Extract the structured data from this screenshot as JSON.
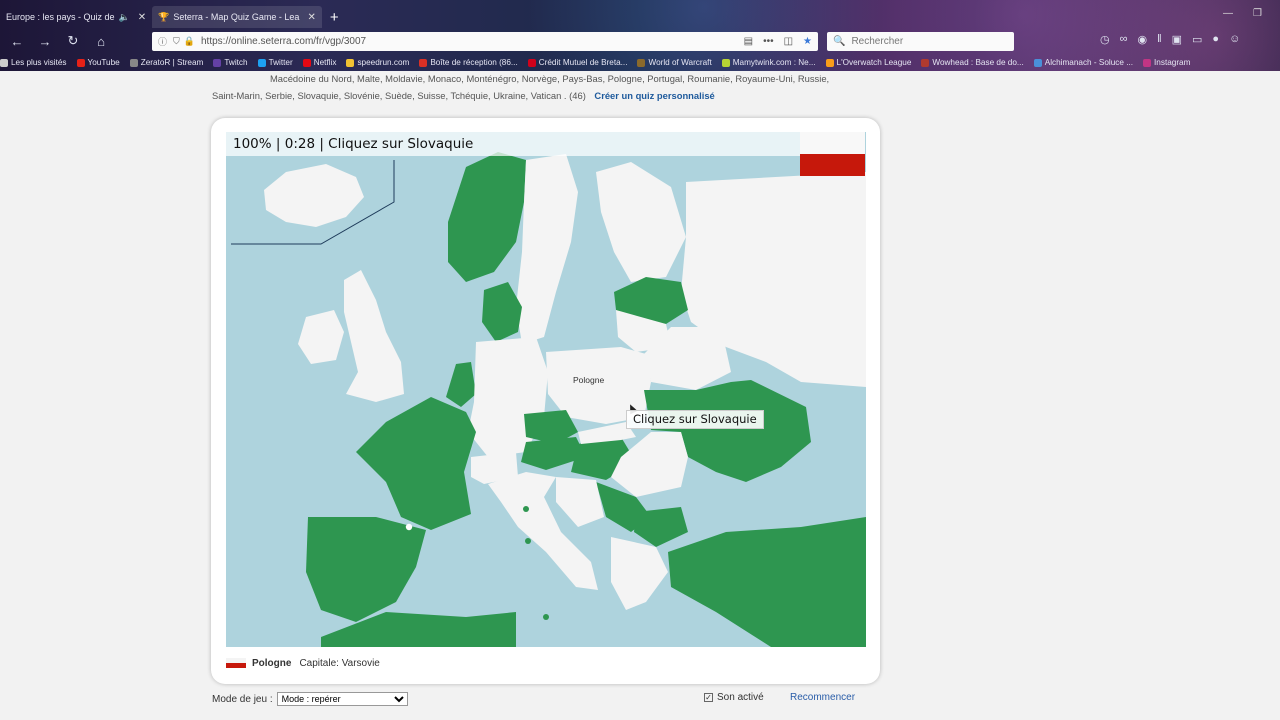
{
  "browser": {
    "tabs": [
      {
        "label": "Europe : les pays - Quiz de",
        "active": false
      },
      {
        "label": "Seterra - Map Quiz Game - Lea",
        "active": true
      }
    ],
    "url": "https://online.seterra.com/fr/vgp/3007",
    "search_placeholder": "Rechercher",
    "bookmarks": [
      {
        "label": "Les plus visités",
        "color": "#cccccc"
      },
      {
        "label": "YouTube",
        "color": "#e62117"
      },
      {
        "label": "ZeratoR | Stream",
        "color": "#888888"
      },
      {
        "label": "Twitch",
        "color": "#6441a5"
      },
      {
        "label": "Twitter",
        "color": "#1da1f2"
      },
      {
        "label": "Netflix",
        "color": "#e50914"
      },
      {
        "label": "speedrun.com",
        "color": "#f1c232"
      },
      {
        "label": "Boîte de réception (86...",
        "color": "#d93025"
      },
      {
        "label": "Crédit Mutuel de Breta...",
        "color": "#d0021b"
      },
      {
        "label": "World of Warcraft",
        "color": "#8b6a2b"
      },
      {
        "label": "Mamytwink.com : Ne...",
        "color": "#b7d334"
      },
      {
        "label": "L'Overwatch League",
        "color": "#f99e1a"
      },
      {
        "label": "Wowhead : Base de do...",
        "color": "#b03a2e"
      },
      {
        "label": "Alchimanach - Soluce ...",
        "color": "#4a90d9"
      },
      {
        "label": "Instagram",
        "color": "#c13584"
      }
    ]
  },
  "page": {
    "country_list_line1": "Macédoine du Nord, Malte, Moldavie, Monaco, Monténégro, Norvège, Pays-Bas, Pologne, Portugal, Roumanie, Royaume-Uni, Russie,",
    "country_list_line2": "Saint-Marin, Serbie, Slovaquie, Slovénie, Suède, Suisse, Tchéquie, Ukraine, Vatican . (46)",
    "custom_quiz_link": "Créer un quiz personnalisé"
  },
  "quiz": {
    "status": "100% | 0:28 | Cliquez sur Slovaquie",
    "score_percent": 100,
    "time": "0:28",
    "prompt_tooltip": "Cliquez sur Slovaquie",
    "hover_country": "Pologne",
    "flag_colors": [
      "#f8f8f8",
      "#c6180b"
    ],
    "found_color": "#2e9650",
    "sea_color": "#aed3dd",
    "land_color": "#f4f4f4"
  },
  "info": {
    "country": "Pologne",
    "capital": "Capitale: Varsovie"
  },
  "controls": {
    "mode_label": "Mode de jeu :",
    "mode_value": "Mode : repérer",
    "sound_label": "Son activé",
    "sound_checked": true,
    "restart_label": "Recommencer"
  }
}
